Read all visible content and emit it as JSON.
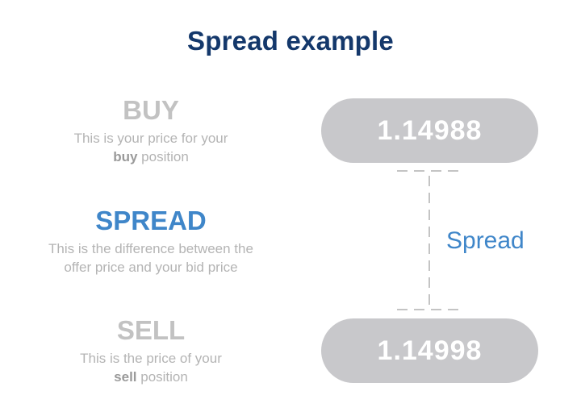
{
  "title": "Spread example",
  "buy": {
    "label": "BUY",
    "desc_line1": "This is your price for your",
    "desc_bold": "buy",
    "desc_rest": " position"
  },
  "spread": {
    "label": "SPREAD",
    "desc_line1": "This is the difference between the",
    "desc_line2": "offer price and your bid price"
  },
  "sell": {
    "label": "SELL",
    "desc_line1": "This is the price of your",
    "desc_bold": "sell",
    "desc_rest": " position"
  },
  "prices": {
    "buy": "1.14988",
    "sell": "1.14998"
  },
  "spread_marker_label": "Spread",
  "colors": {
    "title": "#14386b",
    "accent_blue": "#3f86c9",
    "grey_label": "#c2c2c2",
    "pill": "#c8c8cb"
  }
}
